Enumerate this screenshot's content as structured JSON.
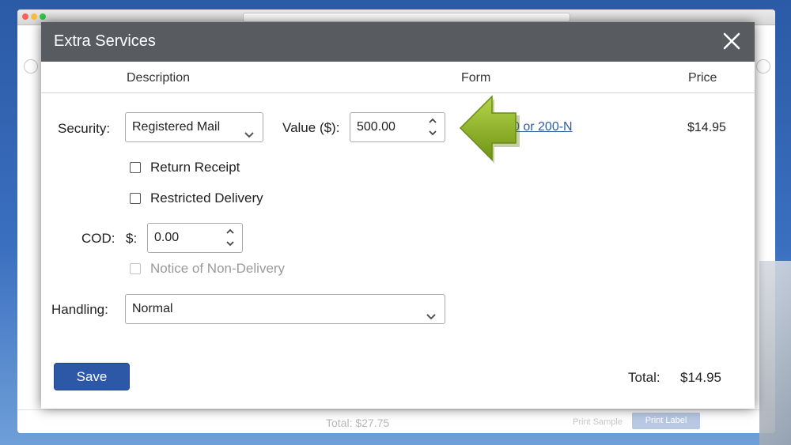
{
  "background": {
    "footer_total": "Total: $27.75",
    "print_sample_label": "Print Sample",
    "print_label_label": "Print Label"
  },
  "modal": {
    "title": "Extra Services",
    "columns": {
      "description": "Description",
      "form": "Form",
      "price": "Price"
    },
    "security": {
      "label": "Security:",
      "selected": "Registered Mail",
      "value_label": "Value ($):",
      "value": "500.00",
      "form_link": "0 or 200-N",
      "price": "$14.95"
    },
    "return_receipt_label": "Return Receipt",
    "restricted_delivery_label": "Restricted Delivery",
    "cod": {
      "label": "COD:",
      "currency": "$:",
      "value": "0.00"
    },
    "notice_non_delivery_label": "Notice of Non-Delivery",
    "handling": {
      "label": "Handling:",
      "selected": "Normal"
    },
    "save_label": "Save",
    "total_label": "Total:",
    "total_value": "$14.95"
  },
  "colors": {
    "header_bg": "#585c61",
    "save_button": "#2d58a8",
    "link": "#2f5b9f",
    "arrow_green": "#8db12a"
  },
  "icons": [
    "close-icon",
    "chevron-down-icon",
    "spinner-arrows-icon",
    "pointer-arrow-icon"
  ]
}
